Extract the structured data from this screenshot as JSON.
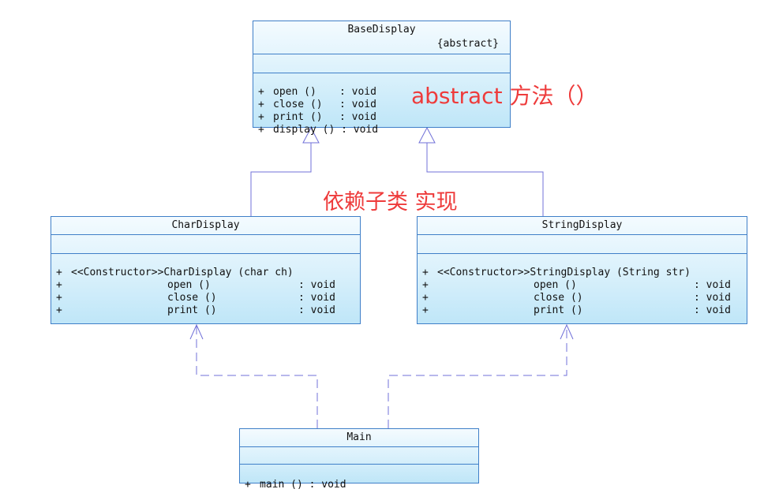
{
  "base": {
    "name": "BaseDisplay",
    "stereotype": "{abstract}",
    "ops": [
      {
        "vis": "+",
        "name": "open ()",
        "ret": ": void"
      },
      {
        "vis": "+",
        "name": "close ()",
        "ret": ": void"
      },
      {
        "vis": "+",
        "name": "print ()",
        "ret": ": void"
      },
      {
        "vis": "+",
        "name": "display () : void",
        "ret": ""
      }
    ]
  },
  "char": {
    "name": "CharDisplay",
    "ops": [
      {
        "vis": "+",
        "name": "<<Constructor>>CharDisplay (char ch)",
        "ret": ""
      },
      {
        "vis": "+",
        "name": "open ()",
        "ret": ": void"
      },
      {
        "vis": "+",
        "name": "close ()",
        "ret": ": void"
      },
      {
        "vis": "+",
        "name": "print ()",
        "ret": ": void"
      }
    ]
  },
  "string": {
    "name": "StringDisplay",
    "ops": [
      {
        "vis": "+",
        "name": "<<Constructor>>StringDisplay (String str)",
        "ret": ""
      },
      {
        "vis": "+",
        "name": "open ()",
        "ret": ": void"
      },
      {
        "vis": "+",
        "name": "close ()",
        "ret": ": void"
      },
      {
        "vis": "+",
        "name": "print ()",
        "ret": ": void"
      }
    ]
  },
  "main": {
    "name": "Main",
    "ops": [
      {
        "vis": "+",
        "name": "main () : void",
        "ret": ""
      }
    ]
  },
  "annotations": {
    "abstract_methods": "abstract  方法（）",
    "subclass_impl": "依赖子类 实现"
  },
  "colors": {
    "class_border": "#3f7fc8",
    "edge": "#6a6ad8",
    "annotation": "#ee3b3b"
  }
}
